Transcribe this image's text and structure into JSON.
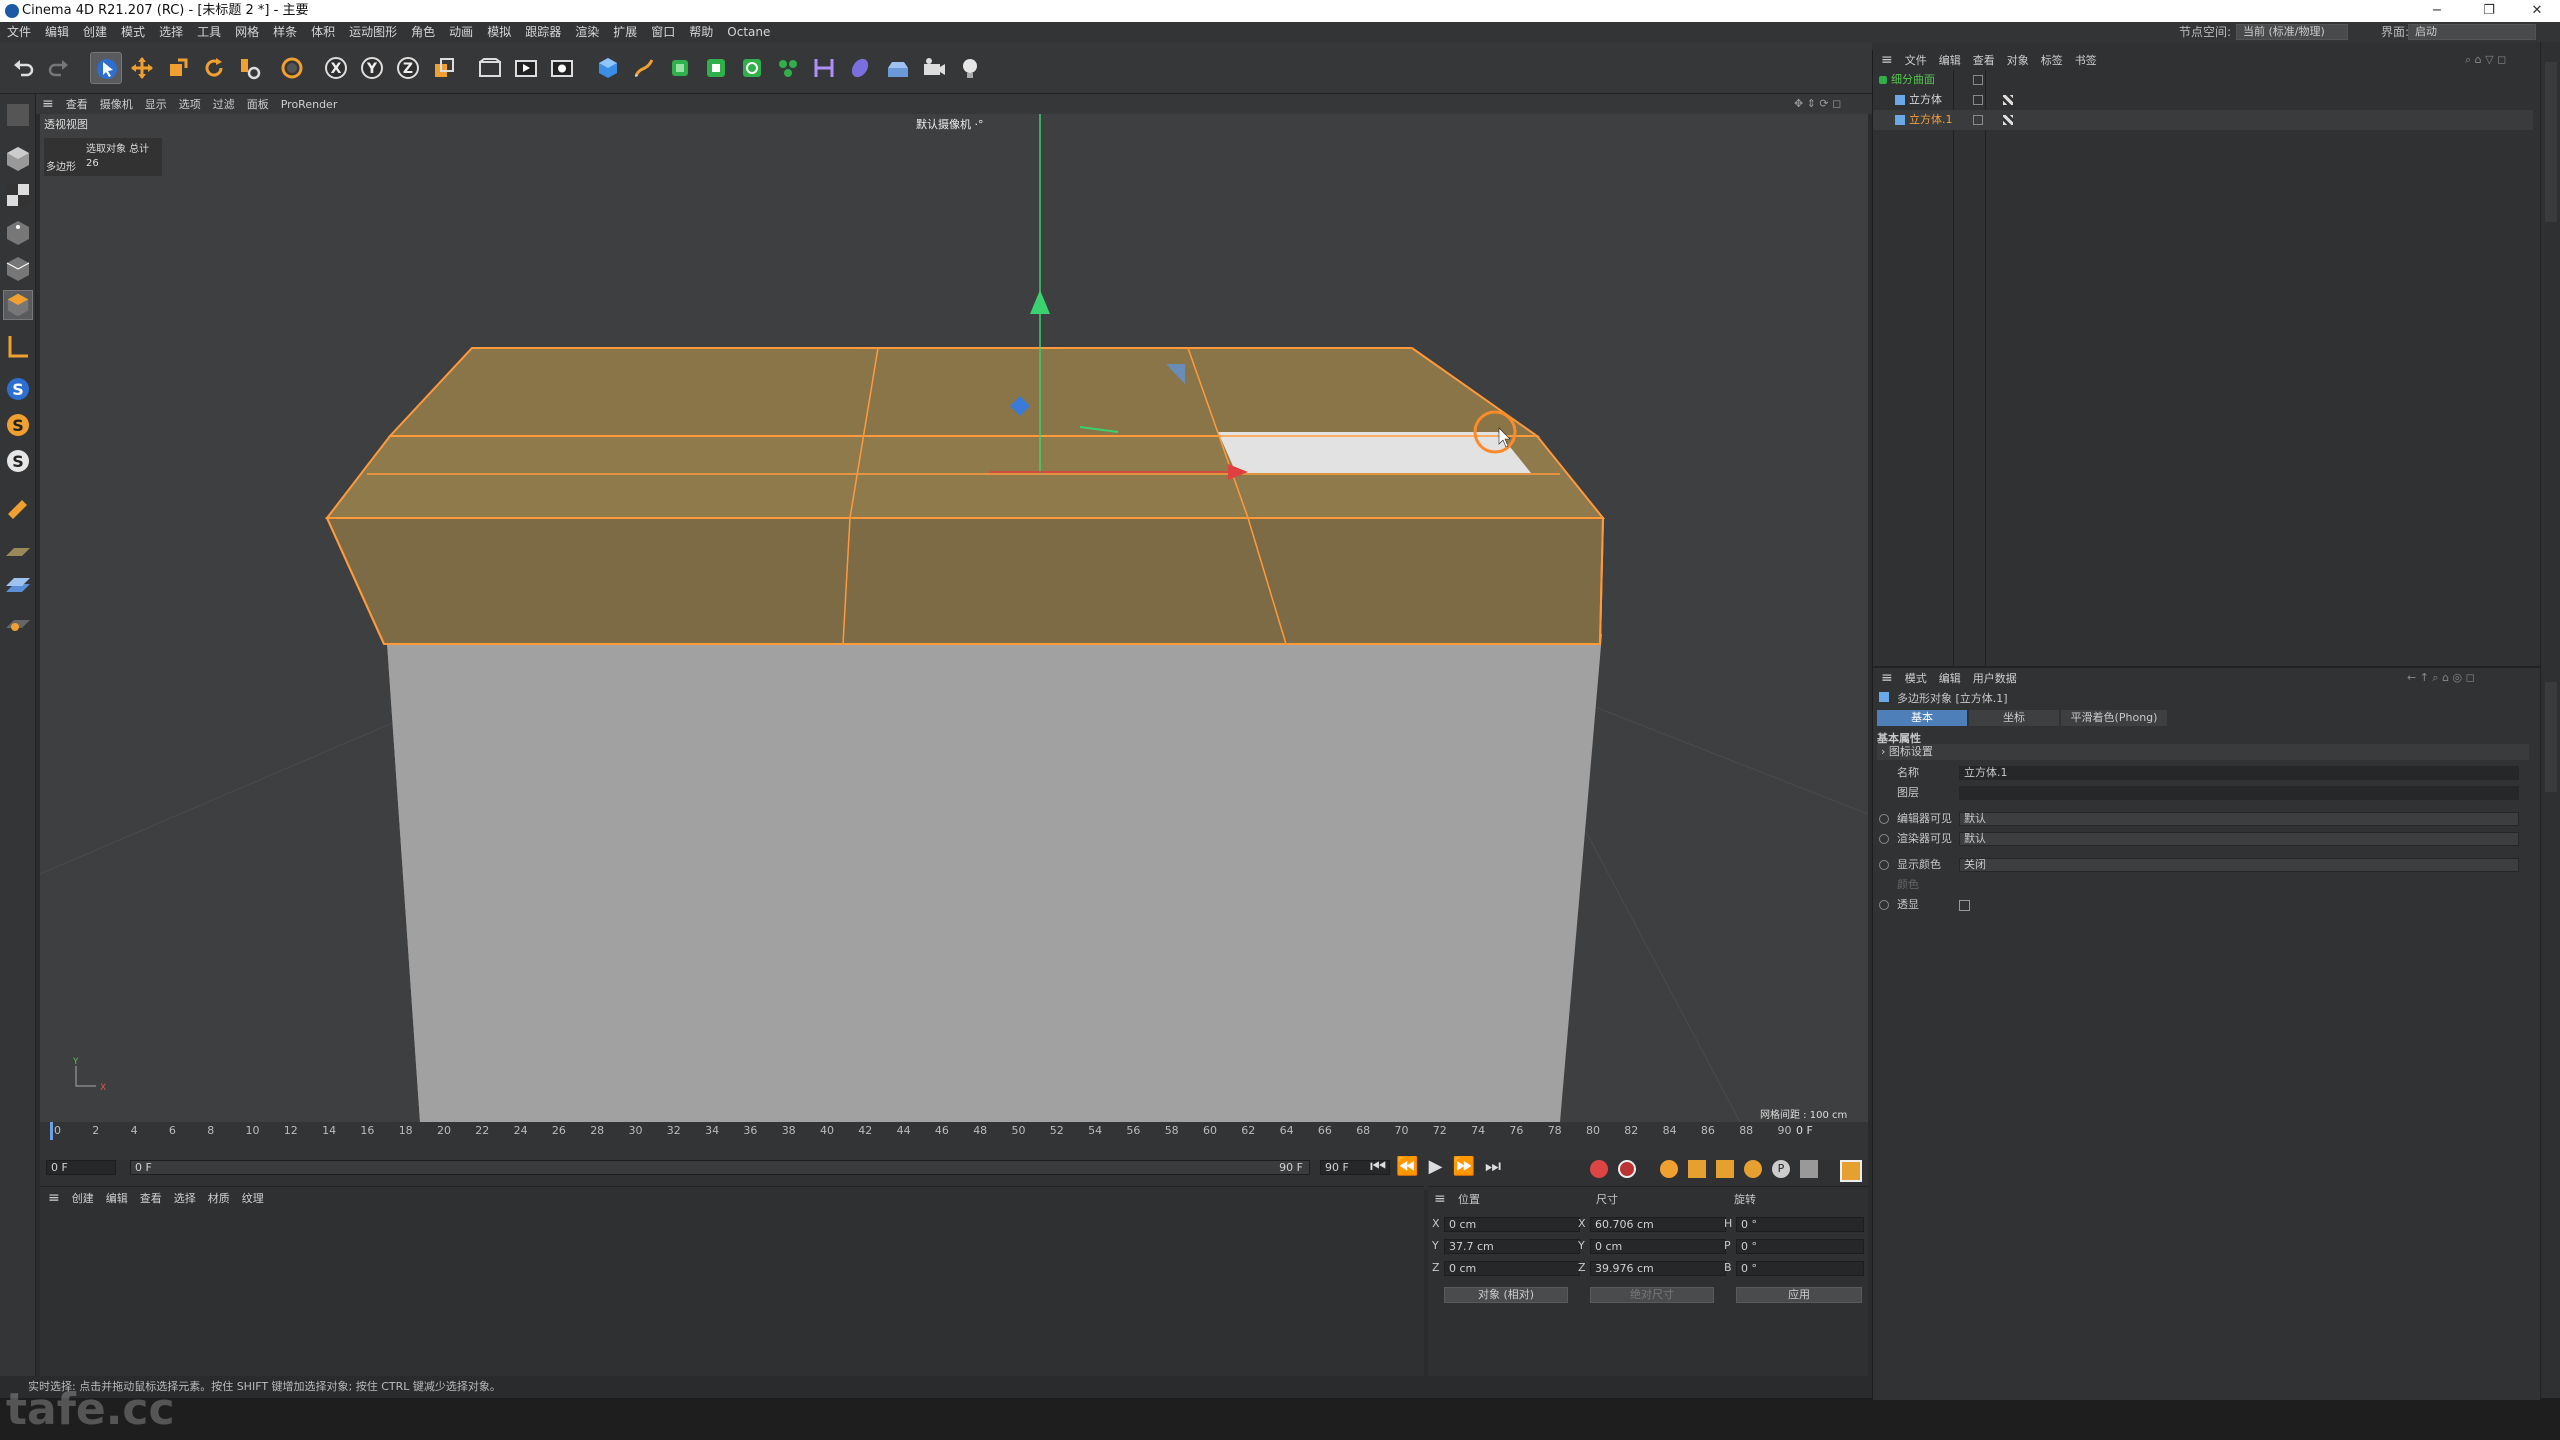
{
  "titlebar": {
    "title": "Cinema 4D R21.207 (RC) - [未标题 2 *] - 主要",
    "minimize": "−",
    "restore": "❐",
    "close": "✕"
  },
  "menubar": {
    "items": [
      "文件",
      "编辑",
      "创建",
      "模式",
      "选择",
      "工具",
      "网格",
      "样条",
      "体积",
      "运动图形",
      "角色",
      "动画",
      "模拟",
      "跟踪器",
      "渲染",
      "扩展",
      "窗口",
      "帮助",
      "Octane"
    ],
    "node_space_label": "节点空间:",
    "node_space_value": "当前 (标准/物理)",
    "layout_label": "界面:",
    "layout_value": "启动"
  },
  "toolbar": {
    "icons": [
      "undo-icon",
      "redo-icon",
      "select-arrow-icon",
      "move-icon",
      "scale-icon",
      "rotate-icon",
      "recent-tool-icon",
      "live-select-icon",
      "x-axis-icon",
      "y-axis-icon",
      "z-axis-icon",
      "coordinate-system-icon",
      "render-view-icon",
      "render-picture-icon",
      "render-settings-icon",
      "cube-icon",
      "pen-icon",
      "subdivision-icon",
      "extrude-icon",
      "cloner-icon",
      "array-icon",
      "deformer-icon",
      "field-icon",
      "floor-icon",
      "camera-icon",
      "light-icon"
    ]
  },
  "viewport_menu": {
    "items": [
      "查看",
      "摄像机",
      "显示",
      "选项",
      "过滤",
      "面板",
      "ProRender"
    ]
  },
  "viewport": {
    "view_name": "透视视图",
    "camera_label": "默认摄像机 ·°",
    "hud_title": "选取对象  总计",
    "hud_label": "多边形",
    "hud_value": "26",
    "grid_spacing": "网格间距 : 100 cm",
    "colors": {
      "bg": "#3e3f40",
      "selected_face": "#8a7548",
      "edge_highlight": "#ff9a3c",
      "cube_side": "#a6a6a6"
    }
  },
  "timeline": {
    "ticks": [
      "0",
      "2",
      "4",
      "6",
      "8",
      "10",
      "12",
      "14",
      "16",
      "18",
      "20",
      "22",
      "24",
      "26",
      "28",
      "30",
      "32",
      "34",
      "36",
      "38",
      "40",
      "42",
      "44",
      "46",
      "48",
      "50",
      "52",
      "54",
      "56",
      "58",
      "60",
      "62",
      "64",
      "66",
      "68",
      "70",
      "72",
      "74",
      "76",
      "78",
      "80",
      "82",
      "84",
      "86",
      "88",
      "90"
    ],
    "current_frame": "0 F",
    "start_field": "0 F",
    "min_field": "0 F",
    "max_label": "90 F",
    "end_field": "90 F"
  },
  "material_manager": {
    "menu": [
      "创建",
      "编辑",
      "查看",
      "选择",
      "材质",
      "纹理"
    ]
  },
  "coord_manager": {
    "headers": {
      "position": "位置",
      "size": "尺寸",
      "rotation": "旋转"
    },
    "rows": [
      {
        "axis": "X",
        "pos": "0 cm",
        "saxis": "X",
        "size": "60.706 cm",
        "raxis": "H",
        "rot": "0 °"
      },
      {
        "axis": "Y",
        "pos": "37.7 cm",
        "saxis": "Y",
        "size": "0 cm",
        "raxis": "P",
        "rot": "0 °"
      },
      {
        "axis": "Z",
        "pos": "0 cm",
        "saxis": "Z",
        "size": "39.976 cm",
        "raxis": "B",
        "rot": "0 °"
      }
    ],
    "mode": "对象 (相对)",
    "size_mode": "绝对尺寸",
    "apply": "应用"
  },
  "status": {
    "text": "实时选择: 点击并拖动鼠标选择元素。按住 SHIFT 键增加选择对象; 按住 CTRL 键减少选择对象。",
    "watermark": "tafe.cc"
  },
  "object_manager": {
    "menu": [
      "文件",
      "编辑",
      "查看",
      "对象",
      "标签",
      "书签"
    ],
    "objects": [
      {
        "name": "细分曲面",
        "color": "#54c44e"
      },
      {
        "name": "立方体",
        "color": "#d8d8d8"
      },
      {
        "name": "立方体.1",
        "color": "#f0a040"
      }
    ]
  },
  "attribute_manager": {
    "menu": [
      "模式",
      "编辑",
      "用户数据"
    ],
    "object_title": "多边形对象 [立方体.1]",
    "tabs": [
      "基本",
      "坐标",
      "平滑着色(Phong)"
    ],
    "section": "基本属性",
    "subsection": "图标设置",
    "rows": [
      {
        "label": "名称",
        "value": "立方体.1"
      },
      {
        "label": "图层",
        "value": ""
      },
      {
        "label": "编辑器可见",
        "value": "默认"
      },
      {
        "label": "渲染器可见",
        "value": "默认"
      },
      {
        "label": "显示颜色",
        "value": "关闭"
      },
      {
        "label": "颜色",
        "value": ""
      },
      {
        "label": "透显",
        "value": ""
      }
    ]
  }
}
